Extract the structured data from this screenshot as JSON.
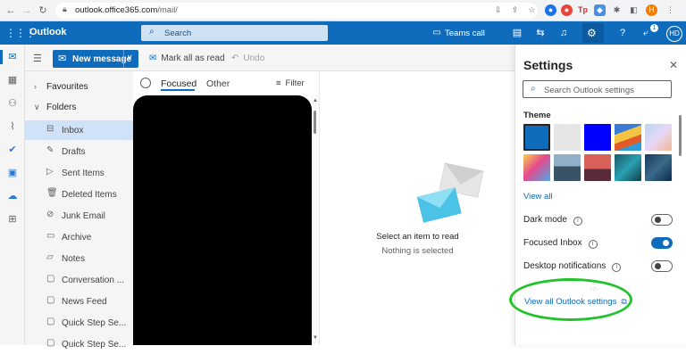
{
  "browser": {
    "url_domain": "outlook.office365.com",
    "url_path": "/mail/",
    "profile_initial": "H"
  },
  "header": {
    "brand": "Outlook",
    "search_placeholder": "Search",
    "teams_call": "Teams call",
    "notif_badge": "1",
    "avatar_initials": "HD"
  },
  "toolbar": {
    "new_message": "New message",
    "mark_all_read": "Mark all as read",
    "undo": "Undo"
  },
  "folders": {
    "favourites": "Favourites",
    "folders_header": "Folders",
    "items": [
      {
        "label": "Inbox",
        "icon": "inbox-icon"
      },
      {
        "label": "Drafts",
        "icon": "pencil-icon"
      },
      {
        "label": "Sent Items",
        "icon": "send-icon"
      },
      {
        "label": "Deleted Items",
        "icon": "trash-icon"
      },
      {
        "label": "Junk Email",
        "icon": "junk-icon"
      },
      {
        "label": "Archive",
        "icon": "archive-icon"
      },
      {
        "label": "Notes",
        "icon": "notes-icon"
      },
      {
        "label": "Conversation ...",
        "icon": "folder-icon"
      },
      {
        "label": "News Feed",
        "icon": "folder-icon"
      },
      {
        "label": "Quick Step Se...",
        "icon": "folder-icon"
      },
      {
        "label": "Quick Step Se...",
        "icon": "folder-icon"
      }
    ]
  },
  "message_list": {
    "tab_focused": "Focused",
    "tab_other": "Other",
    "filter": "Filter"
  },
  "reading_pane": {
    "title": "Select an item to read",
    "subtitle": "Nothing is selected"
  },
  "settings": {
    "title": "Settings",
    "search_placeholder": "Search Outlook settings",
    "theme_label": "Theme",
    "view_all": "View all",
    "dark_mode": "Dark mode",
    "dark_mode_on": false,
    "focused_inbox": "Focused Inbox",
    "focused_inbox_on": true,
    "desktop_notifications": "Desktop notifications",
    "desktop_notifications_on": false,
    "view_all_outlook": "View all Outlook settings",
    "theme_colors": [
      "#0f6cbd",
      "#e6e6e6",
      "#0000ff"
    ]
  },
  "colors": {
    "accent": "#0f6cbd",
    "highlight": "#22c32a"
  }
}
